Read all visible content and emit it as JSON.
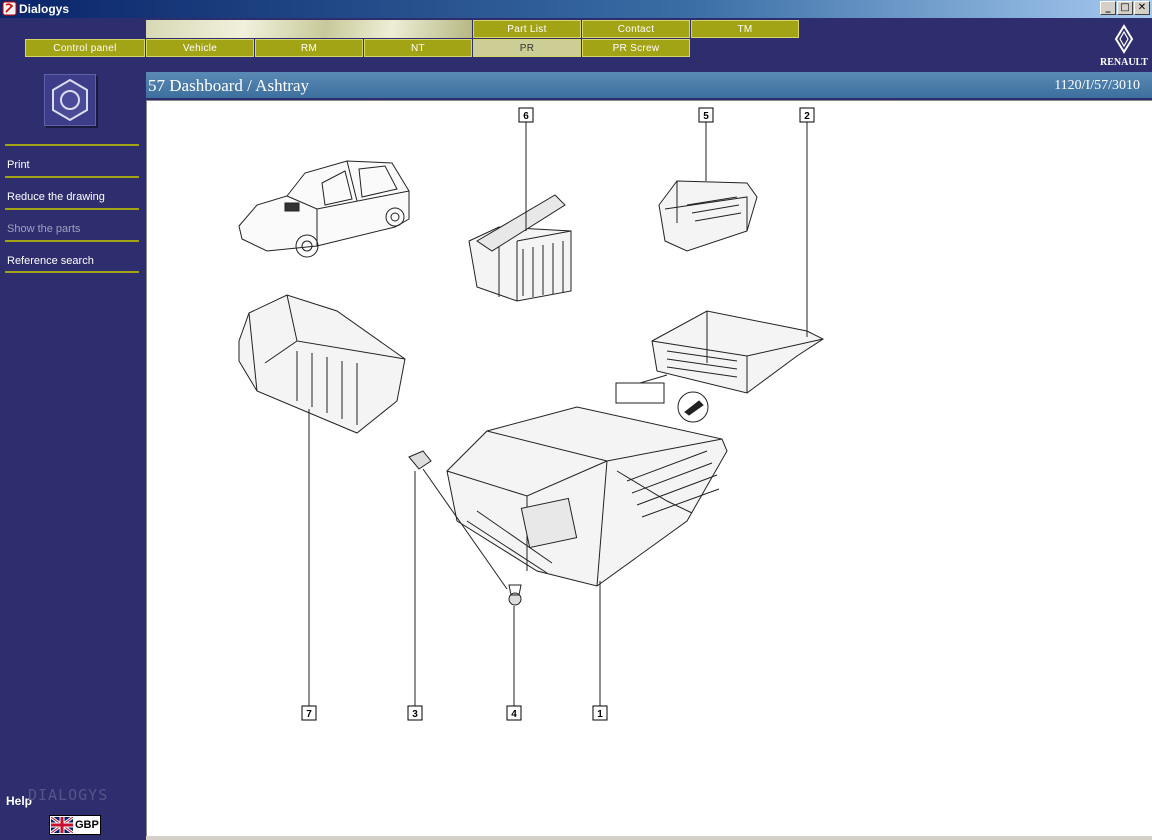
{
  "window": {
    "title": "Dialogys"
  },
  "nav": {
    "top": [
      "Part List",
      "Contact",
      "TM"
    ],
    "main": [
      "Control panel",
      "Vehicle",
      "RM",
      "NT",
      "PR",
      "PR Screw"
    ],
    "active": "PR"
  },
  "brand_logo": "RENAULT",
  "sidebar": {
    "items": [
      {
        "label": "Print"
      },
      {
        "label": "Reduce the drawing"
      },
      {
        "label": "Show the parts"
      },
      {
        "label": "Reference search"
      }
    ],
    "help": "Help",
    "brand": "DIALOGYS",
    "currency": "GBP"
  },
  "page": {
    "title": "57 Dashboard / Ashtray",
    "reference": "1120/I/57/3010"
  },
  "diagram": {
    "callouts": [
      "1",
      "2",
      "3",
      "4",
      "5",
      "6",
      "7"
    ]
  },
  "colors": {
    "frame": "#2e2e6e",
    "nav_button": "#a3a316",
    "nav_active": "#cdcd96",
    "title_bar": "#3d6f9e"
  }
}
